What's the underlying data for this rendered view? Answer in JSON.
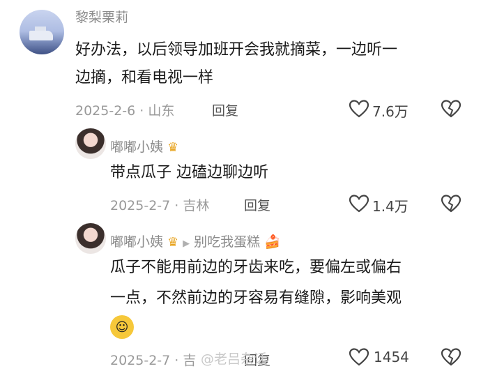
{
  "comments": [
    {
      "username": "黎梨栗莉",
      "text_lines": [
        "好办法，以后领导加班开会我就摘菜，一边听一",
        "边摘，和看电视一样"
      ],
      "date_location": "2025-2-6 · 山东",
      "reply_label": "回复",
      "likes": "7.6万"
    },
    {
      "username": "嘟嘟小姨",
      "text_lines": [
        "带点瓜子  边磕边聊边听"
      ],
      "date_location": "2025-2-7 · 吉林",
      "reply_label": "回复",
      "likes": "1.4万"
    },
    {
      "username": "嘟嘟小姨",
      "reply_to": "别吃我蛋糕",
      "text_lines": [
        "瓜子不能用前边的牙齿来吃，要偏左或偏右",
        "一点，不然前边的牙容易有缝隙，影响美观"
      ],
      "date_location": "2025-2-7 · 吉",
      "reply_label": "回复",
      "likes": "1454"
    }
  ],
  "watermark": "@老吕杂话",
  "icons": {
    "like": "heart-outline-icon",
    "dislike": "broken-heart-icon",
    "badge": "crown-icon",
    "reply_arrow": "triangle-right-icon",
    "cake": "cake-emoji",
    "emoji": "smiling-face-emoji"
  }
}
